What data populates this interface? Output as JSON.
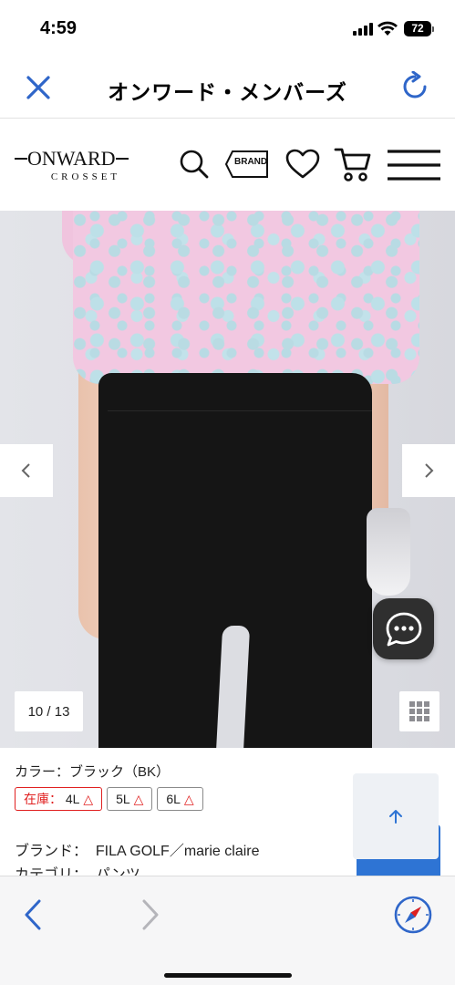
{
  "status_bar": {
    "time": "4:59",
    "battery": "72"
  },
  "browser": {
    "page_title": "オンワード・メンバーズ"
  },
  "site_header": {
    "logo_main": "ONWARD",
    "logo_sub": "CROSSET",
    "brand_icon_label": "BRAND"
  },
  "gallery": {
    "counter": "10 / 13"
  },
  "product": {
    "color_label": "カラー：ブラック（BK）",
    "stock": [
      {
        "prefix": "在庫：",
        "size": "4L",
        "mark": "△"
      },
      {
        "size": "5L",
        "mark": "△"
      },
      {
        "size": "6L",
        "mark": "△"
      }
    ],
    "brand_label": "ブランド：",
    "brand_value": "FILA GOLF／marie claire",
    "category_label": "カテゴリ：",
    "category_value": "パンツ"
  },
  "colors": {
    "accent_blue": "#2f66c9",
    "stock_red": "#e02020",
    "chat_bg": "#2f2f2f"
  }
}
